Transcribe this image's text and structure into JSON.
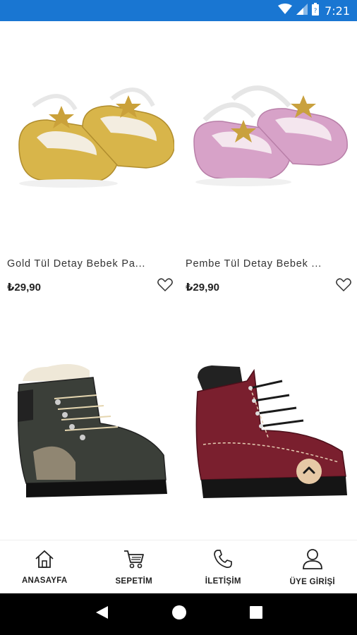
{
  "status_bar": {
    "time": "7:21",
    "icons": [
      "wifi-icon",
      "signal-icon",
      "battery-icon"
    ]
  },
  "products": [
    {
      "name": "Gold Tül Detay Bebek Pa...",
      "price": "₺29,90",
      "shoe_color": "#d8b54a",
      "icon": "baby-shoe-image"
    },
    {
      "name": "Pembe Tül Detay Bebek ...",
      "price": "₺29,90",
      "shoe_color": "#d7a2c8",
      "icon": "baby-shoe-image"
    },
    {
      "name": "",
      "price": "",
      "shoe_color": "#3b3f39",
      "icon": "winter-boot-image"
    },
    {
      "name": "",
      "price": "",
      "shoe_color": "#7a1f2e",
      "icon": "leather-boot-image"
    }
  ],
  "scroll_top": {
    "icon": "chevron-up-icon",
    "color": "#e6c9a6"
  },
  "bottom_nav": {
    "items": [
      {
        "label": "ANASAYFA",
        "icon": "home-icon"
      },
      {
        "label": "SEPETİM",
        "icon": "cart-icon"
      },
      {
        "label": "İLETİŞİM",
        "icon": "phone-icon"
      },
      {
        "label": "ÜYE GİRİŞİ",
        "icon": "user-icon"
      }
    ]
  },
  "system_nav": {
    "icons": [
      "back-icon",
      "home-circle-icon",
      "recents-icon"
    ]
  },
  "colors": {
    "status_bar": "#1976d2",
    "accent": "#e6c9a6"
  }
}
